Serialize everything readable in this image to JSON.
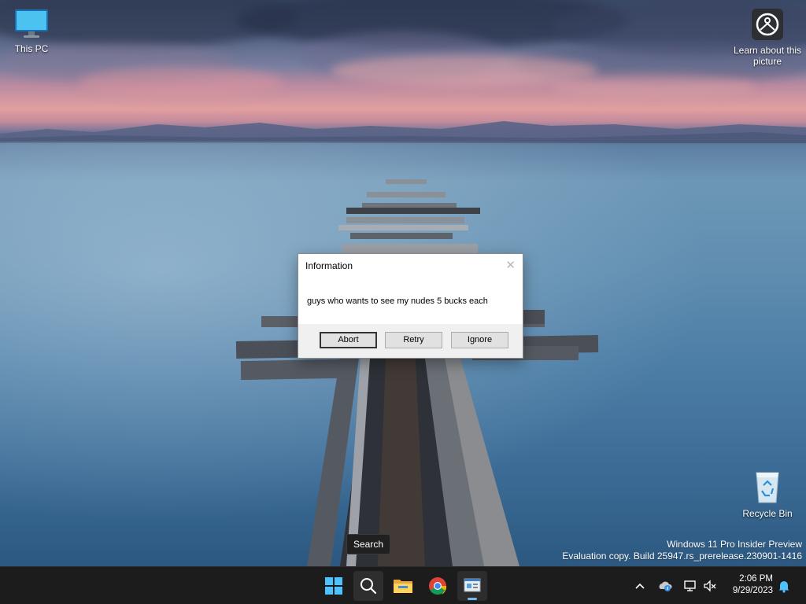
{
  "desktop": {
    "icons": [
      {
        "label": "This PC"
      },
      {
        "label": "Learn about this picture"
      },
      {
        "label": "Recycle Bin"
      }
    ],
    "watermark": {
      "line1": "Windows 11 Pro Insider Preview",
      "line2": "Evaluation copy. Build 25947.rs_prerelease.230901-1416"
    }
  },
  "dialog": {
    "title": "Information",
    "message": "guys who wants to see my nudes 5 bucks each",
    "buttons": {
      "abort": "Abort",
      "retry": "Retry",
      "ignore": "Ignore"
    },
    "close_glyph": "✕"
  },
  "tooltip": {
    "text": "Search"
  },
  "taskbar": {
    "items": [
      "start-icon",
      "search-icon",
      "file-explorer-icon",
      "chrome-icon",
      "app-window-icon"
    ],
    "tray": {
      "chevron": "^",
      "icons": [
        "onedrive-icon",
        "network-icon",
        "volume-muted-icon",
        "notification-bell-icon"
      ]
    },
    "clock": {
      "time": "2:06 PM",
      "date": "9/29/2023"
    }
  },
  "colors": {
    "taskbar_bg": "#1c1c1c",
    "accent": "#76b9ed",
    "dialog_footer": "#f0f0f0"
  }
}
